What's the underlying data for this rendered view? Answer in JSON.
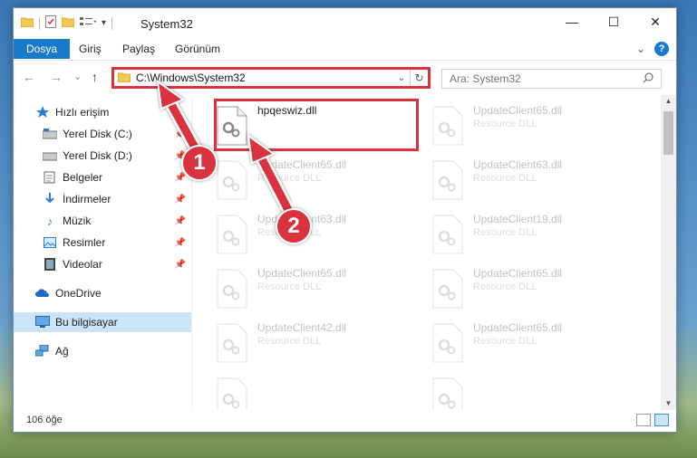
{
  "window": {
    "title": "System32",
    "controls": {
      "minimize": "—",
      "maximize": "☐",
      "close": "✕"
    }
  },
  "ribbon": {
    "tabs": [
      "Dosya",
      "Giriş",
      "Paylaş",
      "Görünüm"
    ]
  },
  "nav": {
    "back": "←",
    "forward": "→",
    "recent": "⌄",
    "up": "↑",
    "address_path": "C:\\Windows\\System32",
    "refresh": "↻",
    "search_placeholder": "Ara: System32"
  },
  "sidebar": {
    "items": [
      {
        "label": "Hızlı erişim",
        "icon": "star-icon"
      },
      {
        "label": "Yerel Disk (C:)",
        "icon": "drive-icon",
        "pinned": true
      },
      {
        "label": "Yerel Disk (D:)",
        "icon": "drive-icon",
        "pinned": true
      },
      {
        "label": "Belgeler",
        "icon": "documents-icon",
        "pinned": true
      },
      {
        "label": "İndirmeler",
        "icon": "download-icon",
        "pinned": true
      },
      {
        "label": "Müzik",
        "icon": "music-icon",
        "pinned": true
      },
      {
        "label": "Resimler",
        "icon": "pictures-icon",
        "pinned": true
      },
      {
        "label": "Videolar",
        "icon": "video-icon",
        "pinned": true
      },
      {
        "label": "OneDrive",
        "icon": "cloud-icon"
      },
      {
        "label": "Bu bilgisayar",
        "icon": "computer-icon",
        "selected": true
      },
      {
        "label": "Ağ",
        "icon": "network-icon"
      }
    ]
  },
  "files": [
    {
      "name": "hpqeswiz.dll",
      "type": "",
      "highlighted": true
    },
    {
      "name": "UpdateClient65.dll",
      "type": "Resource DLL"
    },
    {
      "name": "UpdateClient65.dll",
      "type": "Resource DLL"
    },
    {
      "name": "UpdateClient63.dll",
      "type": "Resource DLL"
    },
    {
      "name": "UpdateClient63.dll",
      "type": "Resource DLL"
    },
    {
      "name": "UpdateClient19.dll",
      "type": "Resource DLL"
    },
    {
      "name": "UpdateClient65.dll",
      "type": "Resource DLL"
    },
    {
      "name": "UpdateClient65.dll",
      "type": "Resource DLL"
    },
    {
      "name": "UpdateClient42.dll",
      "type": "Resource DLL"
    },
    {
      "name": "UpdateClient65.dll",
      "type": "Resource DLL"
    }
  ],
  "status": {
    "item_count": "106 öğe"
  },
  "annotations": {
    "step1": "1",
    "step2": "2",
    "color": "#d9333f"
  }
}
